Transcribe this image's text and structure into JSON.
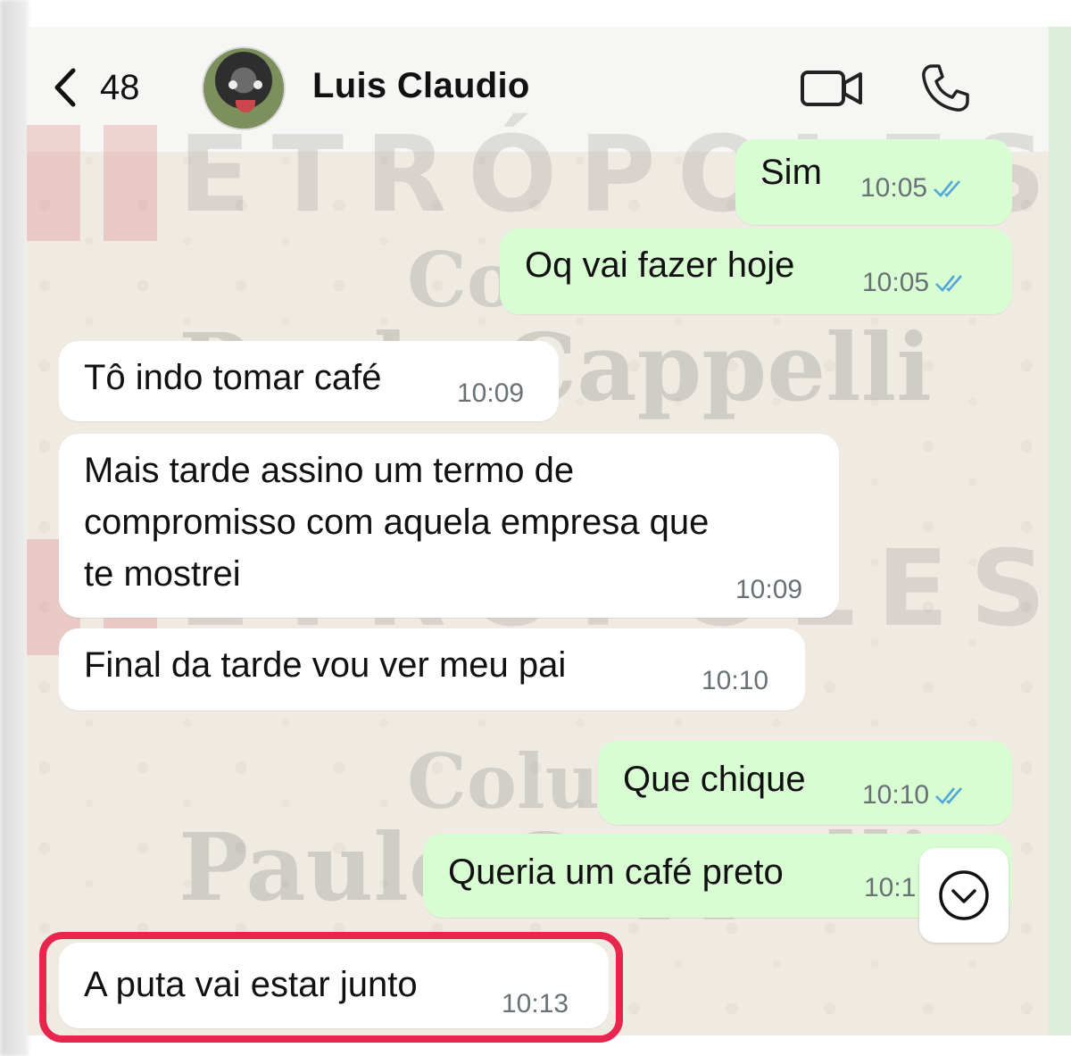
{
  "header": {
    "back_count": "48",
    "contact_name": "Luis Claudio"
  },
  "watermark": {
    "brand": "ETRÓPOLES",
    "column_word": "Coluna",
    "author": "Paulo Cappelli"
  },
  "messages": [
    {
      "direction": "outgoing",
      "text": "Sim",
      "time": "10:05",
      "read": true
    },
    {
      "direction": "outgoing",
      "text": "Oq vai fazer hoje",
      "time": "10:05",
      "read": true
    },
    {
      "direction": "incoming",
      "text": "Tô indo tomar café",
      "time": "10:09"
    },
    {
      "direction": "incoming",
      "text": "Mais tarde assino um termo de\ncompromisso com aquela empresa que\nte mostrei",
      "time": "10:09"
    },
    {
      "direction": "incoming",
      "text": "Final da tarde vou ver meu pai",
      "time": "10:10"
    },
    {
      "direction": "outgoing",
      "text": "Que chique",
      "time": "10:10",
      "read": true
    },
    {
      "direction": "outgoing",
      "text": "Queria um café preto",
      "time": "10:1",
      "read": true
    },
    {
      "direction": "incoming",
      "text": "A puta vai estar junto",
      "time": "10:13",
      "highlighted": true
    }
  ],
  "colors": {
    "outgoing_bubble": "#d9fdd3",
    "incoming_bubble": "#ffffff",
    "chat_background": "#efeae2",
    "highlight_border": "#e8254c",
    "read_ticks": "#53a6d6"
  },
  "icons": [
    "back-chevron-icon",
    "video-call-icon",
    "phone-call-icon",
    "scroll-down-icon",
    "double-check-icon"
  ]
}
